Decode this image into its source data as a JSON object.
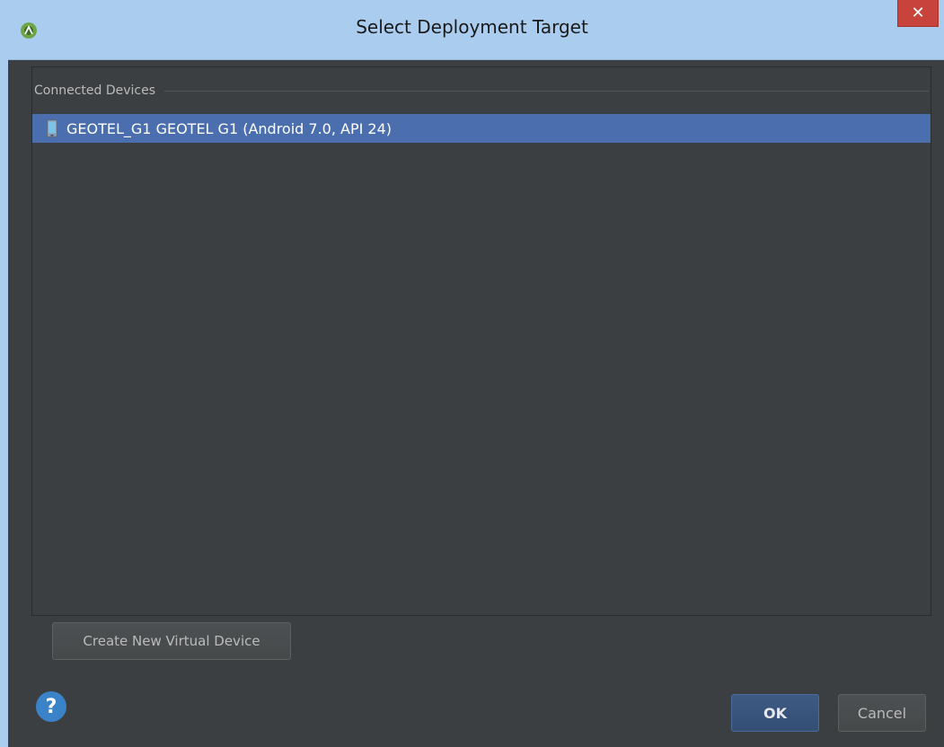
{
  "window": {
    "title": "Select Deployment Target",
    "app_icon": "android-studio-icon",
    "close_label": "✕"
  },
  "devices": {
    "group_label": "Connected Devices",
    "items": [
      {
        "label": "GEOTEL_G1 GEOTEL G1 (Android 7.0, API 24)",
        "icon": "phone-icon",
        "selected": true
      }
    ]
  },
  "actions": {
    "create_label": "Create New Virtual Device",
    "help_label": "?",
    "ok_label": "OK",
    "cancel_label": "Cancel"
  },
  "colors": {
    "background": "#3c3f41",
    "titlebar": "#aaccee",
    "selection": "#4b6eaf",
    "close_button": "#c7433b",
    "help_button": "#3b83c9"
  }
}
